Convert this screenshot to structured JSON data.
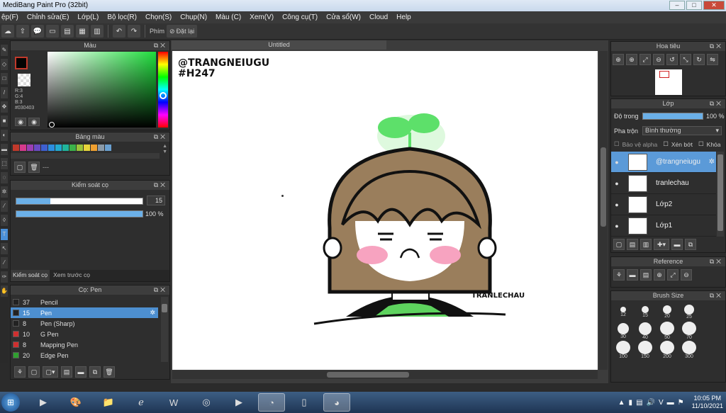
{
  "app": {
    "title": "MediBang Paint Pro (32bit)"
  },
  "window_buttons": [
    "–",
    "□",
    "✕"
  ],
  "menu": [
    "ệp(F)",
    "Chỉnh sửa(E)",
    "Lớp(L)",
    "Bộ lọc(R)",
    "Chọn(S)",
    "Chụp(N)",
    "Màu (C)",
    "Xem(V)",
    "Công cụ(T)",
    "Cửa sổ(W)",
    "Cloud",
    "Help"
  ],
  "toolbar": {
    "shortcut_label": "Phím",
    "reset_label": "Đặt lại"
  },
  "color_panel": {
    "title": "Màu",
    "r": "R:3",
    "g": "G:4",
    "b": "B:3",
    "hex": "#030403",
    "primary": "#030403"
  },
  "palette_panel": {
    "title": "Bảng màu",
    "dash": "---",
    "swatches": [
      "#c0392b",
      "#d63a8c",
      "#9b3fb5",
      "#6a4bc4",
      "#3e5fd0",
      "#2c8ee0",
      "#22aacf",
      "#1fb59c",
      "#3bb34a",
      "#9ac43a",
      "#e7d43a",
      "#f0a030",
      "#8a9aa8",
      "#6aa0d0"
    ]
  },
  "brush_control": {
    "title": "Kiểm soát cọ",
    "size_value": "15",
    "size_fraction": 0.27,
    "opacity_value": "100 %",
    "opacity_fraction": 1.0,
    "tab_control": "Kiểm soát cọ",
    "tab_preview": "Xem trước cọ"
  },
  "brush_panel": {
    "title": "Cọ: Pen",
    "items": [
      {
        "size": "37",
        "name": "Pencil",
        "color": "#222222",
        "selected": false
      },
      {
        "size": "15",
        "name": "Pen",
        "color": "#222222",
        "selected": true
      },
      {
        "size": "8",
        "name": "Pen (Sharp)",
        "color": "#222222",
        "selected": false
      },
      {
        "size": "10",
        "name": "G Pen",
        "color": "#d03030",
        "selected": false
      },
      {
        "size": "8",
        "name": "Mapping Pen",
        "color": "#d03030",
        "selected": false
      },
      {
        "size": "20",
        "name": "Edge Pen",
        "color": "#30a030",
        "selected": false
      }
    ]
  },
  "canvas": {
    "tab": "Untitled",
    "text_line1": "@TRANGNEIUGU",
    "text_line2": "#H247",
    "signature": "TRANLECHAU"
  },
  "navigator": {
    "title": "Hoa tiêu"
  },
  "layers_panel": {
    "title": "Lớp",
    "opacity_label": "Độ trong",
    "opacity_value": "100 %",
    "blend_label": "Pha trộn",
    "blend_value": "Bình thường",
    "protect_alpha": "Bảo vệ alpha",
    "clipping": "Xén bớt",
    "lock": "Khóa",
    "layers": [
      {
        "name": "@trangneiugu",
        "selected": true
      },
      {
        "name": "tranlechau",
        "selected": false
      },
      {
        "name": "Lớp2",
        "selected": false
      },
      {
        "name": "Lớp1",
        "selected": false
      }
    ]
  },
  "reference_panel": {
    "title": "Reference"
  },
  "brush_size_panel": {
    "title": "Brush Size",
    "sizes": [
      "12",
      "15",
      "20",
      "25",
      "30",
      "40",
      "50",
      "70",
      "100",
      "150",
      "200",
      "300"
    ]
  },
  "taskbar": {
    "time": "10:05 PM",
    "date": "11/10/2021"
  }
}
